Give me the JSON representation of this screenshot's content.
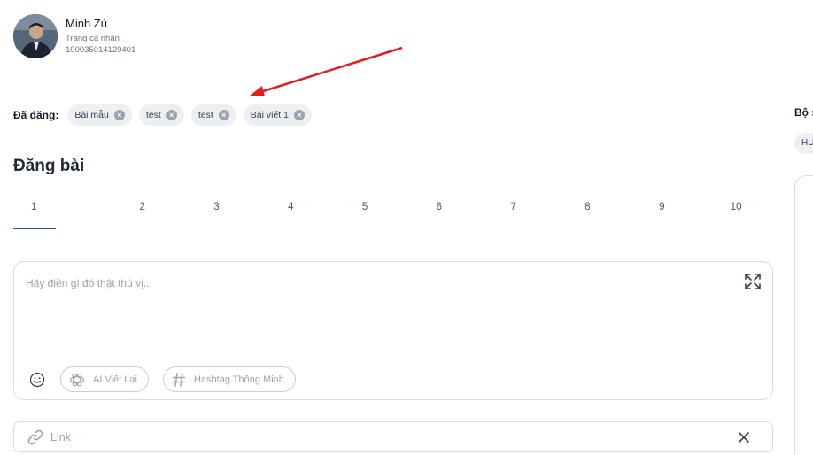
{
  "profile": {
    "name": "Minh Zú",
    "subtitle": "Trang cá nhân",
    "id": "100035014129401"
  },
  "posted": {
    "label": "Đã đăng:",
    "chips": [
      "Bài mẫu",
      "test",
      "test",
      "Bài viết 1"
    ]
  },
  "compose": {
    "title": "Đăng bài",
    "tabs": [
      "1",
      "2",
      "3",
      "4",
      "5",
      "6",
      "7",
      "8",
      "9",
      "10"
    ],
    "active_tab": "1",
    "placeholder": "Hãy điền gì đó thật thú vị...",
    "ai_rewrite_label": "AI Viết Lại",
    "hashtag_label": "Hashtag Thông Minh",
    "link_placeholder": "Link"
  },
  "right_panel": {
    "title": "Bộ s",
    "chip": "HU"
  },
  "colors": {
    "accent": "#2f5597",
    "annotation_arrow": "#e11d1d"
  },
  "icons": {
    "expand": "expand-icon",
    "emoji": "smiley-icon",
    "ai": "openai-icon",
    "hashtag": "hashtag-icon",
    "link": "link-icon",
    "clear": "close-icon"
  }
}
